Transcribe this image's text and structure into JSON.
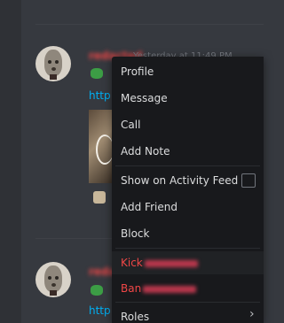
{
  "messages": [
    {
      "username": "redacted",
      "timestamp": "Yesterday at 11:49 PM",
      "link_text": "http"
    },
    {
      "username": "redacted",
      "link_text": "http"
    }
  ],
  "context_menu": {
    "items": [
      {
        "label": "Profile"
      },
      {
        "label": "Message"
      },
      {
        "label": "Call"
      },
      {
        "label": "Add Note"
      },
      {
        "label": "Show on Activity Feed"
      },
      {
        "label": "Add Friend"
      },
      {
        "label": "Block"
      },
      {
        "label": "Kick"
      },
      {
        "label": "Ban"
      },
      {
        "label": "Roles"
      }
    ],
    "submenu_arrow": "›"
  },
  "colors": {
    "background": "#36393f",
    "menu_background": "#18191c",
    "danger": "#f04747",
    "link": "#00b0f4"
  }
}
